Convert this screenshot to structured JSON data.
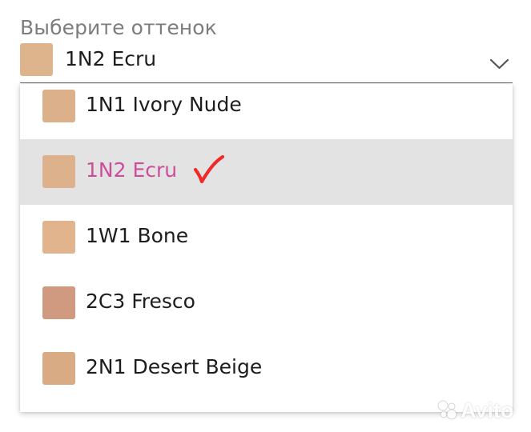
{
  "select": {
    "label": "Выберите оттенок",
    "selected": {
      "label": "1N2 Ecru",
      "swatch_color": "#ddb48c"
    },
    "chevron_icon": "chevron-down-icon"
  },
  "dropdown": {
    "options": [
      {
        "label": "1N1 Ivory Nude",
        "swatch_color": "#dbb08a",
        "selected": false
      },
      {
        "label": "1N2 Ecru",
        "swatch_color": "#dcb18b",
        "selected": true,
        "marker": "red-checkmark-icon"
      },
      {
        "label": "1W1 Bone",
        "swatch_color": "#e1b48d",
        "selected": false
      },
      {
        "label": "2C3 Fresco",
        "swatch_color": "#cf9a7f",
        "selected": false
      },
      {
        "label": "2N1 Desert Beige",
        "swatch_color": "#d9ab84",
        "selected": false
      }
    ]
  },
  "colors": {
    "selected_row_background": "#e3e3e3",
    "selected_text": "#cc4d9b",
    "checkmark": "#f02a2a",
    "label": "#7d7d7d",
    "text": "#1d1d1d"
  },
  "watermark": {
    "text": "Avito",
    "icon": "avito-logo-icon"
  }
}
